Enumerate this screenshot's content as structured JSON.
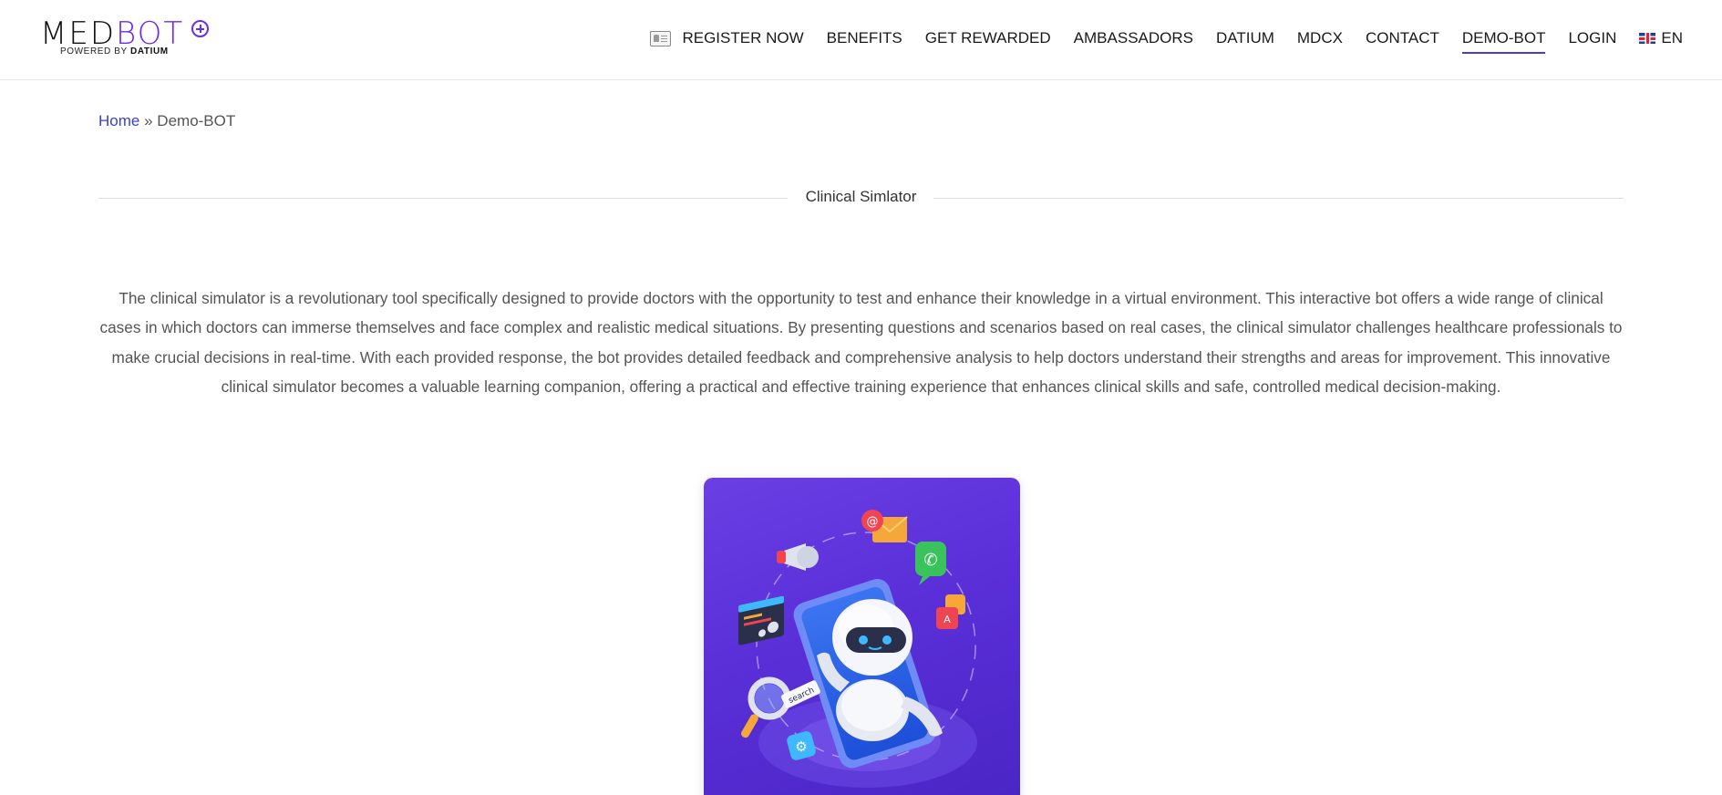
{
  "brand": {
    "logo_med": "MED",
    "logo_bot": "BOT",
    "logo_powered_by": "POWERED BY",
    "logo_datium": "DATIUM",
    "accent_color": "#6a2cf0"
  },
  "nav": {
    "items": [
      {
        "label": "REGISTER NOW",
        "icon": "id-card-icon"
      },
      {
        "label": "BENEFITS"
      },
      {
        "label": "GET REWARDED"
      },
      {
        "label": "AMBASSADORS"
      },
      {
        "label": "DATIUM"
      },
      {
        "label": "MDCX"
      },
      {
        "label": "CONTACT"
      },
      {
        "label": "DEMO-BOT",
        "active": true
      },
      {
        "label": "LOGIN"
      }
    ],
    "language": {
      "label": "EN",
      "icon": "uk-flag-icon"
    },
    "active_underline_color": "#4a3bd6"
  },
  "breadcrumb": {
    "home": "Home",
    "separator": "»",
    "current": "Demo-BOT",
    "link_color": "#3b3fd8"
  },
  "section": {
    "title": "Clinical Simlator"
  },
  "description": "The clinical simulator is a revolutionary tool specifically designed to provide doctors with the opportunity to test and enhance their knowledge in a virtual environment. This interactive bot offers a wide range of clinical cases in which doctors can immerse themselves and face complex and realistic medical situations. By presenting questions and scenarios based on real cases, the clinical simulator challenges healthcare professionals to make crucial decisions in real-time. With each provided response, the bot provides detailed feedback and comprehensive analysis to help doctors understand their strengths and areas for improvement. This innovative clinical simulator becomes a valuable learning companion, offering a practical and effective training experience that enhances clinical skills and safe, controlled medical decision-making.",
  "illustration": {
    "icon": "robot-phone-illustration",
    "search_tag": "search",
    "background_color": "#5a2fd8"
  }
}
